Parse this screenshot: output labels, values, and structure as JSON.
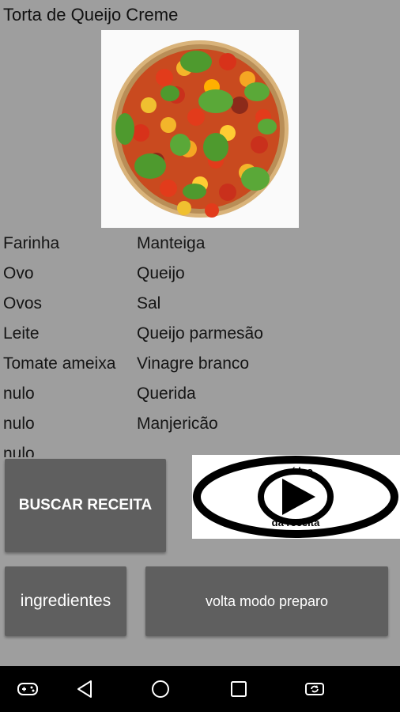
{
  "recipe": {
    "title": "Torta de Queijo Creme",
    "image_alt": "tomato tart with basil"
  },
  "ingredients": {
    "rows": [
      {
        "left": "Farinha",
        "right": "Manteiga"
      },
      {
        "left": "Ovo",
        "right": "Queijo"
      },
      {
        "left": "Ovos",
        "right": "Sal"
      },
      {
        "left": "Leite",
        "right": "Queijo parmesão"
      },
      {
        "left": "Tomate ameixa",
        "right": "Vinagre branco"
      },
      {
        "left": "nulo",
        "right": "Querida"
      },
      {
        "left": "nulo",
        "right": "Manjericão"
      },
      {
        "left": "nulo",
        "right": ""
      }
    ]
  },
  "buttons": {
    "search": "BUSCAR RECEITA",
    "ingredients": "ingredientes",
    "mode": "volta modo preparo"
  },
  "video": {
    "top_text": "vídeo",
    "bottom_text": "da receita",
    "icon": "play-icon"
  },
  "navbar": {
    "icons": [
      "gamepad-icon",
      "back-icon",
      "home-icon",
      "recents-icon",
      "screen-rotate-icon"
    ]
  },
  "colors": {
    "background": "#9e9e9e",
    "button": "#5f5f5f",
    "navbar": "#000000"
  }
}
